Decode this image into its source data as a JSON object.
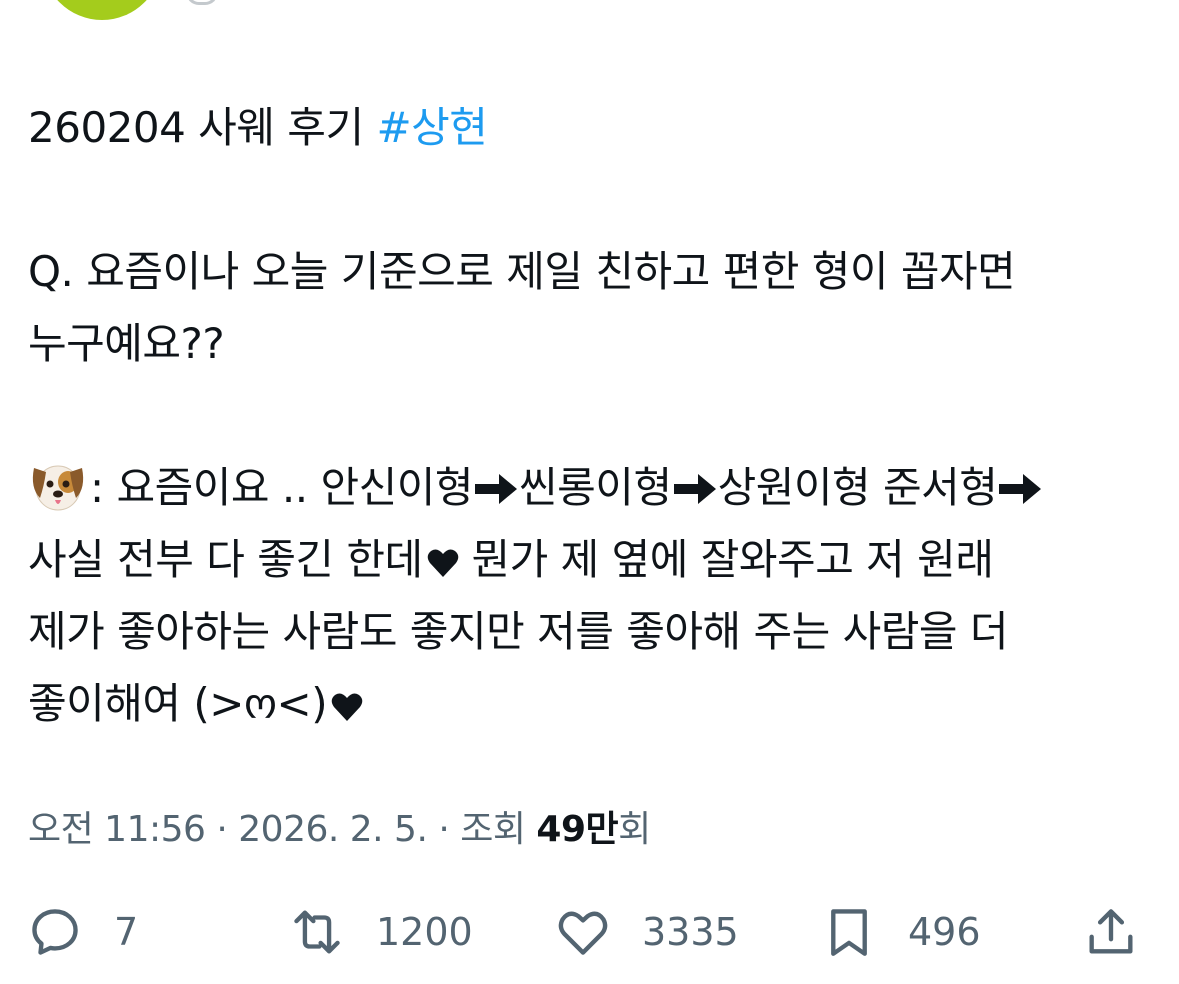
{
  "tweet": {
    "line1_text": "260204 사웨 후기 ",
    "hashtag": "#상현",
    "question_line1": "Q. 요즘이나 오늘 기준으로 제일 친하고 편한 형이 꼽자면",
    "question_line2": "누구예요??",
    "answer_prefix": ": 요즘이요 .. 안신이형",
    "answer_part2": "씬롱이형",
    "answer_part3": "상원이형 준서형",
    "answer_line2": "사실 전부 다 좋긴 한데",
    "answer_line2b": " 뭔가 제 옆에 잘와주고 저 원래",
    "answer_line3": "제가 좋아하는 사람도 좋지만 저를 좋아해 주는 사람을 더",
    "answer_line4": "좋이해여 (>ო<)"
  },
  "meta": {
    "time": "오전 11:56 · 2026. 2. 5. · 조회 ",
    "views_count": "49만",
    "views_suffix": "회"
  },
  "actions": {
    "reply_count": "7",
    "retweet_count": "1200",
    "like_count": "3335",
    "bookmark_count": "496"
  },
  "colors": {
    "hashtag": "#1d9bf0",
    "text": "#0f1419",
    "secondary": "#536471",
    "avatar": "#a4cc1c"
  },
  "icons": [
    "dog-face-icon",
    "arrow-right-icon",
    "heart-icon",
    "reply-icon",
    "retweet-icon",
    "like-icon",
    "bookmark-icon",
    "share-icon"
  ]
}
